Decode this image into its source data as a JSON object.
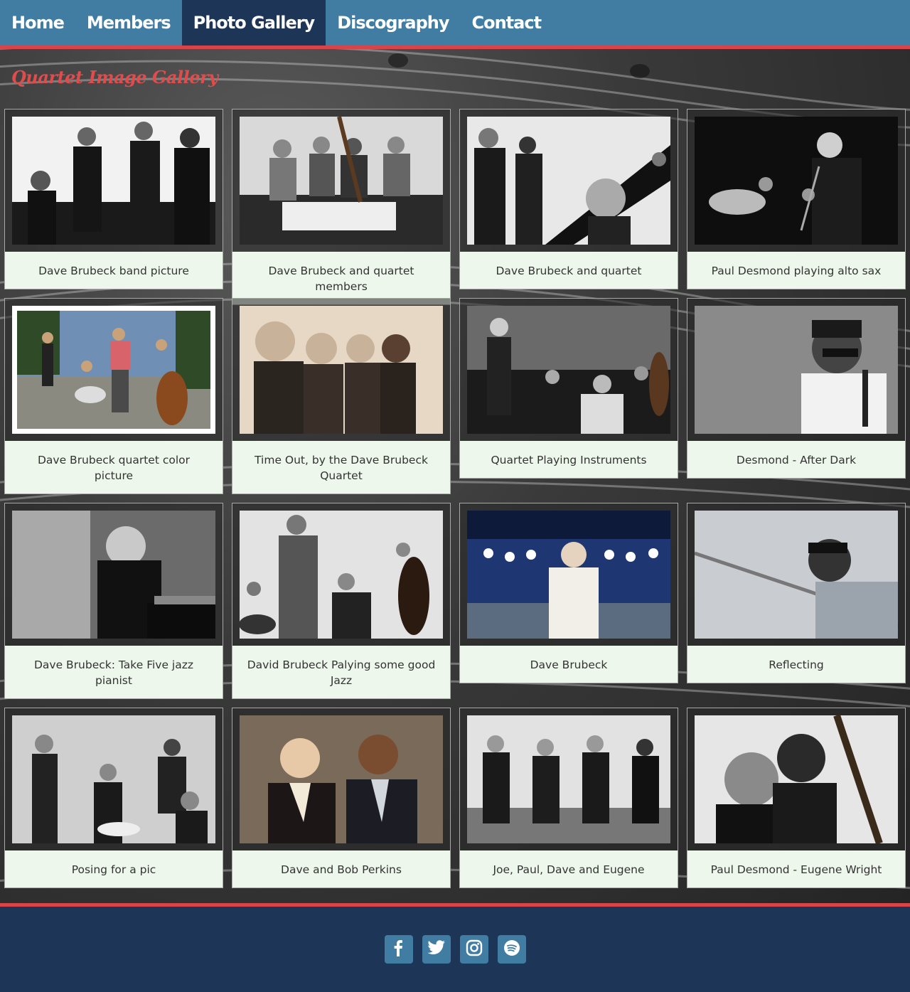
{
  "nav": {
    "items": [
      {
        "label": "Home"
      },
      {
        "label": "Members"
      },
      {
        "label": "Photo Gallery"
      },
      {
        "label": "Discography"
      },
      {
        "label": "Contact"
      }
    ],
    "active": "Photo Gallery"
  },
  "page_title": "Quartet Image Gallery",
  "gallery": [
    {
      "caption": "Dave Brubeck band picture"
    },
    {
      "caption": "Dave Brubeck and quartet members"
    },
    {
      "caption": "Dave Brubeck and quartet"
    },
    {
      "caption": "Paul Desmond playing alto sax"
    },
    {
      "caption": "Dave Brubeck quartet color picture"
    },
    {
      "caption": "Time Out, by the Dave Brubeck Quartet"
    },
    {
      "caption": "Quartet Playing Instruments"
    },
    {
      "caption": "Desmond - After Dark"
    },
    {
      "caption": "Dave Brubeck: Take Five jazz pianist"
    },
    {
      "caption": "David Brubeck Palying some good Jazz"
    },
    {
      "caption": "Dave Brubeck"
    },
    {
      "caption": "Reflecting"
    },
    {
      "caption": "Posing for a pic"
    },
    {
      "caption": "Dave and Bob Perkins"
    },
    {
      "caption": "Joe, Paul, Dave and Eugene"
    },
    {
      "caption": "Paul Desmond - Eugene Wright"
    }
  ],
  "footer": {
    "social": [
      {
        "icon": "facebook-icon"
      },
      {
        "icon": "twitter-icon"
      },
      {
        "icon": "instagram-icon"
      },
      {
        "icon": "spotify-icon"
      }
    ]
  },
  "colors": {
    "nav_bg": "#417ca3",
    "nav_active": "#1d3557",
    "accent_red": "#d9434a",
    "title_red": "#e04c4c",
    "caption_bg": "#eef7ec",
    "footer_bg": "#1d3557"
  }
}
